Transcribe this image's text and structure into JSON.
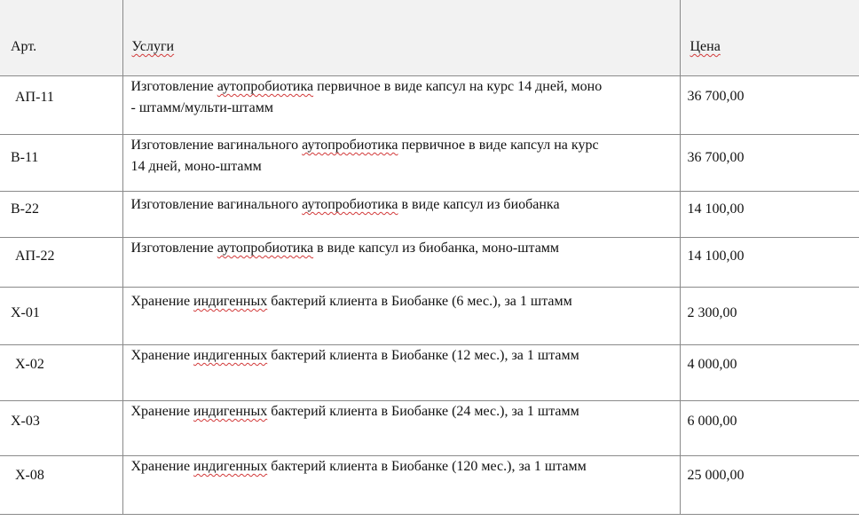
{
  "header": {
    "art": "Арт.",
    "service": "Услуги",
    "price": "Цена"
  },
  "rows": [
    {
      "art": "АП-11",
      "service_lines": [
        "Изготовление ",
        "аутопробиотика",
        " первичное в виде капсул на курс 14 дней, моно",
        "- штамм/мульти-штамм"
      ],
      "price": "36 700,00"
    },
    {
      "art": "В-11",
      "service_lines": [
        "Изготовление вагинального ",
        "аутопробиотика",
        " первичное в виде капсул на курс",
        "14 дней, моно-штамм"
      ],
      "price": "36 700,00"
    },
    {
      "art": "В-22",
      "service_lines": [
        "Изготовление вагинального ",
        "аутопробиотика",
        " в виде капсул из биобанка",
        ""
      ],
      "price": "14 100,00"
    },
    {
      "art": "АП-22",
      "service_lines": [
        "Изготовление ",
        "аутопробиотика",
        " в виде капсул из биобанка, моно-штамм",
        ""
      ],
      "price": "14 100,00"
    },
    {
      "art": "Х-01",
      "service_lines": [
        "Хранение ",
        "индигенных",
        " бактерий клиента в Биобанке (6 мес.), за 1 штамм",
        ""
      ],
      "price": "2 300,00"
    },
    {
      "art": "Х-02",
      "service_lines": [
        "Хранение ",
        "индигенных",
        " бактерий клиента в Биобанке (12 мес.), за 1 штамм",
        ""
      ],
      "price": "4 000,00"
    },
    {
      "art": "Х-03",
      "service_lines": [
        "Хранение ",
        "индигенных",
        " бактерий клиента в Биобанке (24 мес.), за 1 штамм",
        ""
      ],
      "price": "6 000,00"
    },
    {
      "art": "Х-08",
      "service_lines": [
        "Хранение ",
        "индигенных",
        " бактерий клиента в Биобанке (120 мес.), за 1 штамм",
        ""
      ],
      "price": "25 000,00"
    }
  ]
}
